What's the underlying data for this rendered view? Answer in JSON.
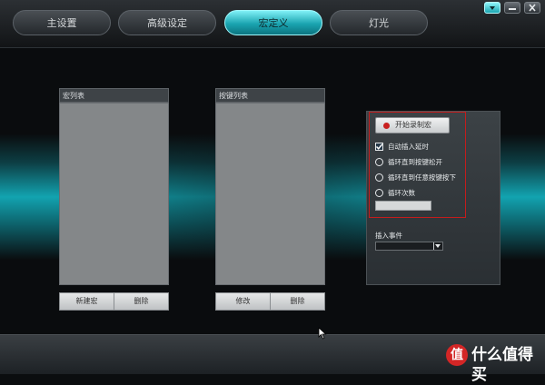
{
  "tabs": [
    {
      "label": "主设置",
      "active": false
    },
    {
      "label": "高级设定",
      "active": false
    },
    {
      "label": "宏定义",
      "active": true
    },
    {
      "label": "灯光",
      "active": false
    }
  ],
  "window_controls": {
    "icons": [
      "dropdown-icon",
      "minimize-icon",
      "close-icon"
    ]
  },
  "macro_list": {
    "title": "宏列表",
    "new_button": "新建宏",
    "delete_button": "删除"
  },
  "key_list": {
    "title": "按键列表",
    "edit_button": "修改",
    "delete_button": "删除"
  },
  "macro_options": {
    "record_button": "开始录制宏",
    "auto_insert_delay": {
      "label": "自动插入延时",
      "checked": true
    },
    "loops": [
      {
        "label": "循环直到按键松开",
        "selected": false
      },
      {
        "label": "循环直到任意按键按下",
        "selected": false
      },
      {
        "label": "循环次数",
        "selected": false
      }
    ],
    "loop_count_value": "",
    "insert_event_label": "插入事件",
    "insert_event_value": ""
  },
  "watermark": {
    "logo_glyph": "值",
    "text": "什么值得买"
  },
  "colors": {
    "accent": "#1aa4b0",
    "highlight_border": "#c41c1c",
    "record_dot": "#c8201f"
  }
}
